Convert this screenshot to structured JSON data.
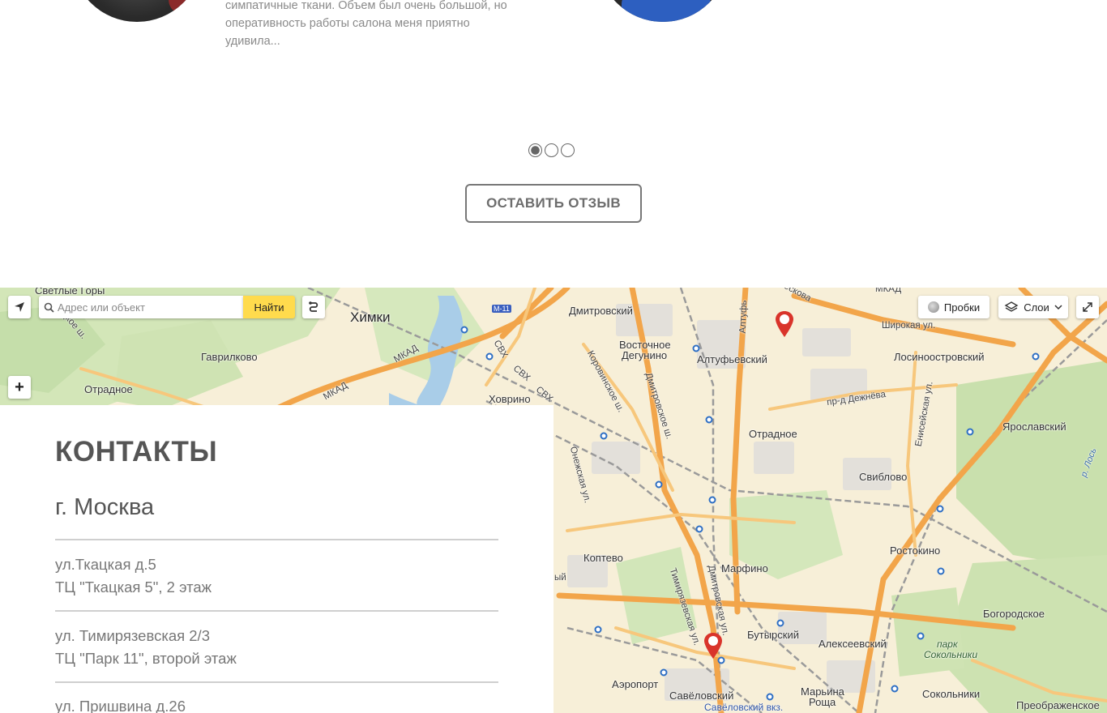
{
  "reviews": {
    "review_1_lines": [
      "симпатичные ткани. Объем был очень большой, но",
      "оперативность работы салона меня приятно",
      "удивила..."
    ],
    "leave_review_label": "ОСТАВИТЬ ОТЗЫВ",
    "slider_count": 3,
    "slider_active": 1
  },
  "map": {
    "search_placeholder": "Адрес или объект",
    "find_label": "Найти",
    "zoom_in_label": "+",
    "traffic_label": "Пробки",
    "layers_label": "Слои",
    "labels": {
      "svetlye_gory": "Светлые Горы",
      "khimki": "Химки",
      "gavrilkovo": "Гаврилково",
      "otradnoe_west": "Отрадное",
      "khovrino": "Ховрино",
      "dmitrovsky": "Дмитровский",
      "vostochnoe_degunino_1": "Восточное",
      "vostochnoe_degunino_2": "Дегунино",
      "altufevsky": "Алтуфьевский",
      "losinoostrovsky": "Лосиноостровский",
      "shirokaya": "Широкая ул.",
      "dezhneva": "пр-д Дежнёва",
      "otradnoe_east": "Отрадное",
      "yaroslavsky": "Ярославский",
      "sviblovo": "Свиблово",
      "koptevo": "Коптево",
      "marfino": "Марфино",
      "rostokino": "Ростокино",
      "bogorodskoe": "Богородское",
      "butyrsky": "Бутырский",
      "alekseevsky": "Алексеевский",
      "park_sokolniki_1": "парк",
      "park_sokolniki_2": "Сокольники",
      "aeroport": "Аэропорт",
      "savelovsky": "Савёловский",
      "savelovsky_vkz": "Савёловский вкз.",
      "marina_roshcha_1": "Марьина",
      "marina_roshcha_2": "Роща",
      "sokolniki": "Сокольники",
      "preobrazhenskoe": "Преображенское",
      "mkad_1": "МКАД",
      "mkad_2": "МКАД",
      "mkad_3": "МКАД",
      "m11": "М-11",
      "svkh_1": "СВХ",
      "svkh_2": "СВХ",
      "svkh_3": "СВХ",
      "korovinskoe": "Коровинское ш.",
      "dmitrovskoe_sh": "Дмитровское ш.",
      "dmitrovskaya_ul": "Дмитровская ул.",
      "timiryazevskaya_ul": "Тимирязевская ул.",
      "altufevskoe": "Алтуфь",
      "eniseyskaya": "Енисейская ул.",
      "onezhskaya": "Онежская ул.",
      "r_los": "р. Лось",
      "leningradskoe": "ицкое ш.",
      "moskova": "ескова",
      "yj": "ый"
    }
  },
  "contacts": {
    "title": "КОНТАКТЫ",
    "city": "г. Москва",
    "addresses": [
      {
        "line1": "ул.Ткацкая д.5",
        "line2": "ТЦ \"Ткацкая 5\", 2 этаж"
      },
      {
        "line1": "ул. Тимирязевская 2/3",
        "line2": "ТЦ \"Парк 11\", второй этаж"
      },
      {
        "line1": "ул. Пришвина д.26",
        "line2": ""
      }
    ]
  },
  "colors": {
    "accent_yellow": "#ffdb4d",
    "marker_red": "#d9342b",
    "road_orange": "#f2a54a",
    "park_green": "#cfe3b3",
    "water_blue": "#a9cde8"
  }
}
